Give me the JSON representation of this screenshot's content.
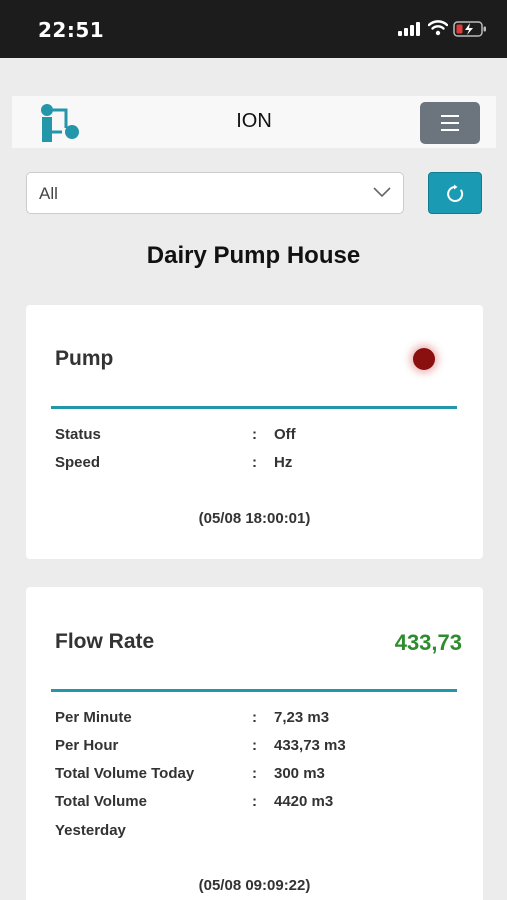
{
  "status_bar": {
    "time": "22:51"
  },
  "navbar": {
    "brand": "ION"
  },
  "filter": {
    "selected": "All"
  },
  "page_title": "Dairy Pump House",
  "pump_card": {
    "title": "Pump",
    "indicator_color": "#8a0f0f",
    "rows": [
      {
        "label": "Status",
        "colon": ":",
        "value": "Off"
      },
      {
        "label": "Speed",
        "colon": ":",
        "value": "Hz"
      }
    ],
    "timestamp": "(05/08 18:00:01)"
  },
  "flow_card": {
    "title": "Flow Rate",
    "current_value": "433,73",
    "value_color": "#2e8b2e",
    "rows": [
      {
        "label": "Per Minute",
        "colon": ":",
        "value": "7,23 m3"
      },
      {
        "label": "Per Hour",
        "colon": ":",
        "value": "433,73 m3"
      },
      {
        "label": "Total Volume Today",
        "colon": ":",
        "value": "300 m3"
      },
      {
        "label": "Total Volume",
        "colon": ":",
        "value": "4420 m3"
      },
      {
        "label": "Yesterday",
        "colon": "",
        "value": ""
      }
    ],
    "timestamp": "(05/08 09:09:22)"
  }
}
